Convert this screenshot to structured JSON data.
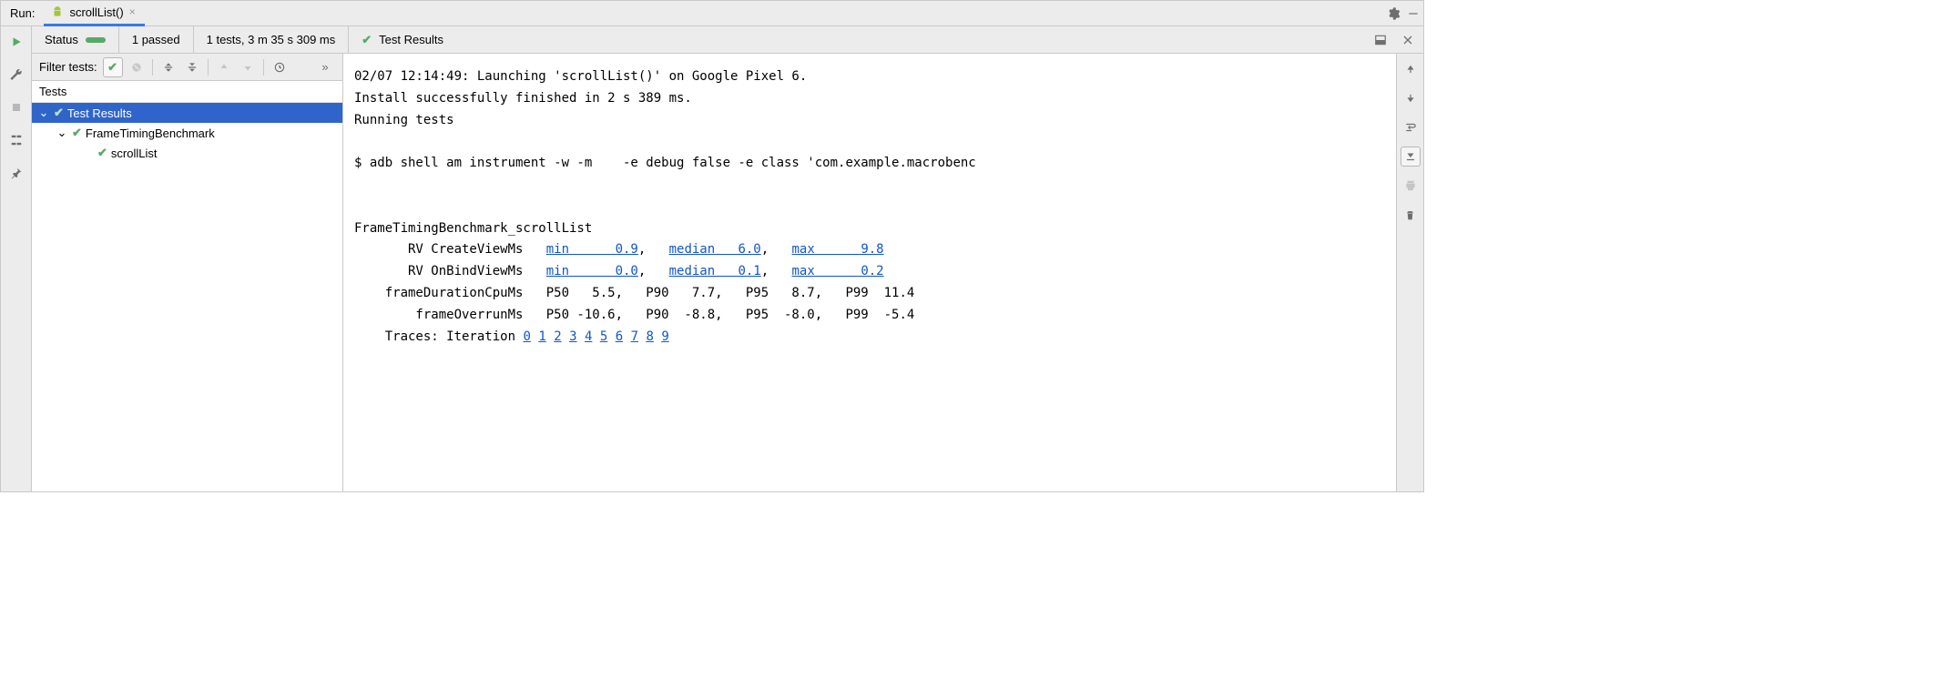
{
  "header": {
    "run_label": "Run:",
    "tab_name": "scrollList()"
  },
  "status": {
    "label": "Status",
    "passed": "1 passed",
    "summary": "1 tests, 3 m 35 s 309 ms"
  },
  "console_header": "Test Results",
  "filter": {
    "label": "Filter tests:"
  },
  "tree": {
    "header": "Tests",
    "root": "Test Results",
    "class_name": "FrameTimingBenchmark",
    "test_name": "scrollList"
  },
  "console": {
    "line_launch": "02/07 12:14:49: Launching 'scrollList()' on Google Pixel 6.",
    "line_install": "Install successfully finished in 2 s 389 ms.",
    "line_running": "Running tests",
    "line_cmd": "$ adb shell am instrument -w -m    -e debug false -e class 'com.example.macrobenc",
    "bench_title": "FrameTimingBenchmark_scrollList",
    "metrics": [
      {
        "name": "RV CreateViewMs",
        "link_style": true,
        "stats": [
          {
            "label": "min",
            "value": "0.9"
          },
          {
            "label": "median",
            "value": "6.0"
          },
          {
            "label": "max",
            "value": "9.8"
          }
        ]
      },
      {
        "name": "RV OnBindViewMs",
        "link_style": true,
        "stats": [
          {
            "label": "min",
            "value": "0.0"
          },
          {
            "label": "median",
            "value": "0.1"
          },
          {
            "label": "max",
            "value": "0.2"
          }
        ]
      },
      {
        "name": "frameDurationCpuMs",
        "link_style": false,
        "stats": [
          {
            "label": "P50",
            "value": "5.5"
          },
          {
            "label": "P90",
            "value": "7.7"
          },
          {
            "label": "P95",
            "value": "8.7"
          },
          {
            "label": "P99",
            "value": "11.4"
          }
        ]
      },
      {
        "name": "frameOverrunMs",
        "link_style": false,
        "stats": [
          {
            "label": "P50",
            "value": "-10.6"
          },
          {
            "label": "P90",
            "value": "-8.8"
          },
          {
            "label": "P95",
            "value": "-8.0"
          },
          {
            "label": "P99",
            "value": "-5.4"
          }
        ]
      }
    ],
    "traces_label": "Traces: Iteration",
    "iterations": [
      "0",
      "1",
      "2",
      "3",
      "4",
      "5",
      "6",
      "7",
      "8",
      "9"
    ]
  },
  "icons": {
    "gear": "gear",
    "minimize": "minimize"
  }
}
